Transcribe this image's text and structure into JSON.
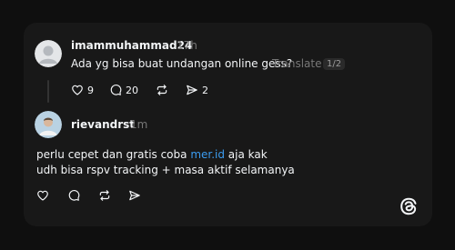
{
  "post": {
    "username": "imammuhammad24",
    "time": "17h",
    "text": "Ada yg bisa buat undangan online gess?",
    "translate_label": "Translate",
    "pager": "1/2",
    "actions": {
      "like_icon": "heart-icon",
      "like_count": "9",
      "reply_icon": "comment-icon",
      "reply_count": "20",
      "repost_icon": "repost-icon",
      "share_icon": "send-icon",
      "share_count": "2"
    }
  },
  "reply": {
    "username": "rievandrst",
    "time": "1m",
    "line1_before": "perlu cepet dan gratis coba ",
    "line1_link": "mer.id",
    "line1_after": " aja kak",
    "line2": "udh bisa rspv tracking + masa aktif selamanya",
    "actions": {
      "like_icon": "heart-icon",
      "reply_icon": "comment-icon",
      "repost_icon": "repost-icon",
      "share_icon": "send-icon"
    }
  },
  "brand": {
    "logo": "threads-logo-icon"
  },
  "colors": {
    "background": "#0f0f0f",
    "card": "#181818",
    "text": "#f3f5f7",
    "muted": "#777777",
    "link": "#3b9cf0"
  }
}
